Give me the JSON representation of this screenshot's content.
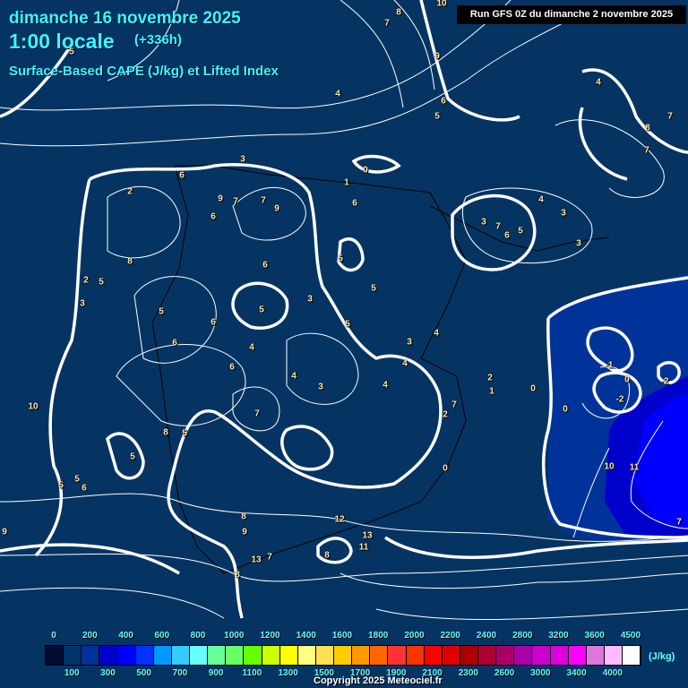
{
  "header": {
    "date": "dimanche 16 novembre 2025",
    "time": "1:00 locale",
    "lead": "(+336h)",
    "parameter": "Surface-Based CAPE (J/kg) et Lifted Index",
    "run": "Run GFS 0Z du dimanche 2 novembre 2025"
  },
  "contour_labels": [
    "10",
    "8",
    "7",
    "9",
    "5",
    "4",
    "4",
    "5",
    "6",
    "7",
    "8",
    "7",
    "6",
    "3",
    "0",
    "1",
    "2",
    "7",
    "6",
    "9",
    "7",
    "9",
    "8",
    "6",
    "3",
    "7",
    "6",
    "5",
    "4",
    "3",
    "3",
    "3",
    "5",
    "2",
    "5",
    "5",
    "6",
    "5",
    "6",
    "5",
    "3",
    "3",
    "4",
    "4",
    "3",
    "6",
    "4",
    "5",
    "4",
    "6",
    "7",
    "4",
    "7",
    "8",
    "5",
    "10",
    "5",
    "5",
    "5",
    "6",
    "2",
    "0",
    "0",
    "0",
    "1",
    "2",
    "0",
    "-1",
    "-2",
    "-2",
    "10",
    "11",
    "7",
    "8",
    "9",
    "12",
    "13",
    "11",
    "13",
    "7",
    "8",
    "8",
    "9"
  ],
  "colorbar": {
    "top_labels": [
      "0",
      "200",
      "400",
      "600",
      "800",
      "1000",
      "1200",
      "1400",
      "1600",
      "1800",
      "2000",
      "2200",
      "2400",
      "2800",
      "3200",
      "3600",
      "4500"
    ],
    "bottom_labels": [
      "100",
      "300",
      "500",
      "700",
      "900",
      "1100",
      "1300",
      "1500",
      "1700",
      "1900",
      "2100",
      "2300",
      "2600",
      "3000",
      "3400",
      "4000"
    ],
    "unit": "(J/kg)",
    "colors": [
      "#000c33",
      "#00336a",
      "#003399",
      "#0000cc",
      "#0000ff",
      "#0033ff",
      "#0099ff",
      "#33ccff",
      "#66ffff",
      "#66ff99",
      "#66ff66",
      "#66ff00",
      "#ccff00",
      "#ffff00",
      "#ffff80",
      "#ffe050",
      "#ffcc00",
      "#ff9900",
      "#ff6600",
      "#ff3333",
      "#ff3300",
      "#ff0000",
      "#dd0000",
      "#aa0000",
      "#aa0033",
      "#aa0066",
      "#aa00aa",
      "#cc00cc",
      "#dd00dd",
      "#ff00ff",
      "#dd77dd",
      "#ffbbff",
      "#ffffff"
    ]
  },
  "copyright": "Copyright 2025 Meteociel.fr",
  "colors": {
    "background": "#053463",
    "title": "#33ffff",
    "cape_low": "#003399",
    "cape_mid": "#0000cc",
    "cape_high": "#0000ff"
  }
}
